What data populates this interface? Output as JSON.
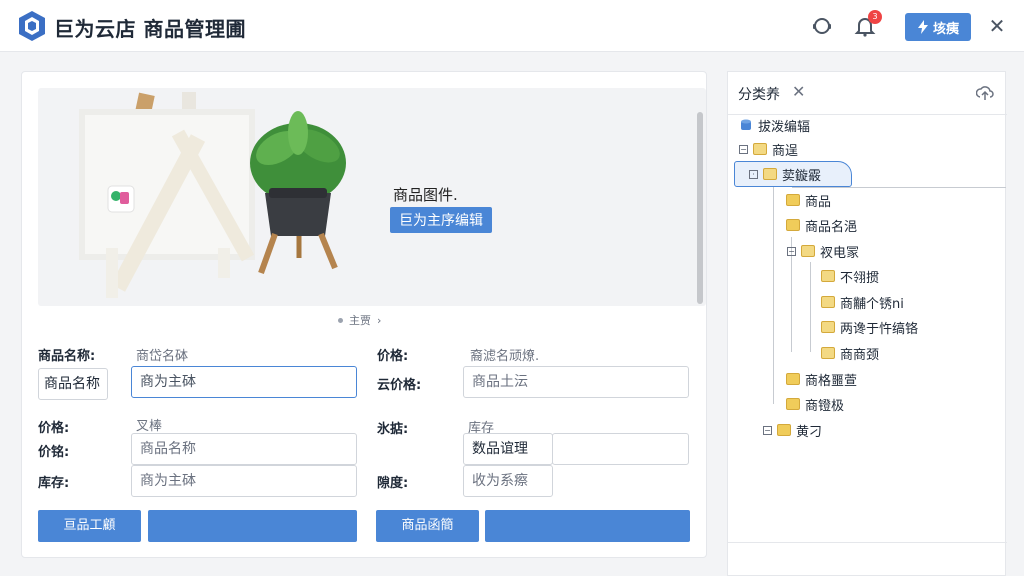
{
  "app": {
    "title": "巨为云店 商品管理圃",
    "notification_count": "3",
    "upload_label": "垓痍"
  },
  "gallery": {
    "caption": "商品图件.",
    "edit_button": "巨为主序编辑",
    "pager_label": "主贾"
  },
  "form": {
    "left": {
      "label1": "商品名称:",
      "hint1": "商岱名砵",
      "tag_value": "商品名称",
      "input1_value": "商为主砵",
      "label2": "价格:",
      "hint2": "叉棒",
      "label3": "价铭:",
      "input3_value": "商品名称",
      "label4": "库存:",
      "input4_value": "商为主砵",
      "btn1": "亘品工顧",
      "btn2": ""
    },
    "right": {
      "label1": "价格:",
      "hint1": "裔滤名顽燎.",
      "label2": "云价格:",
      "input2_value": "商品土沄",
      "label3": "氷掂:",
      "hint3": "库存",
      "input3_value": "数品谊理",
      "label4": "隙度:",
      "input4_value": "收为系瘵",
      "btn1": "商品函簡",
      "btn2": ""
    }
  },
  "side": {
    "title": "分类养",
    "tree": [
      {
        "label": "拔泼编辐"
      },
      {
        "label": "商逞"
      },
      {
        "label": "荬鏇霰"
      },
      {
        "label": "商品"
      },
      {
        "label": "商品名浥"
      },
      {
        "label": "衩电冡"
      },
      {
        "label": "不翎掼"
      },
      {
        "label": "商黼个锈ni"
      },
      {
        "label": "两谗于忤缟铬"
      },
      {
        "label": "商商颈"
      },
      {
        "label": "商格噩萱"
      },
      {
        "label": "商镫极"
      },
      {
        "label": "黄刁"
      }
    ]
  },
  "colors": {
    "accent": "#4a86d6",
    "badge": "#ef4444",
    "folder": "#f3d983"
  }
}
